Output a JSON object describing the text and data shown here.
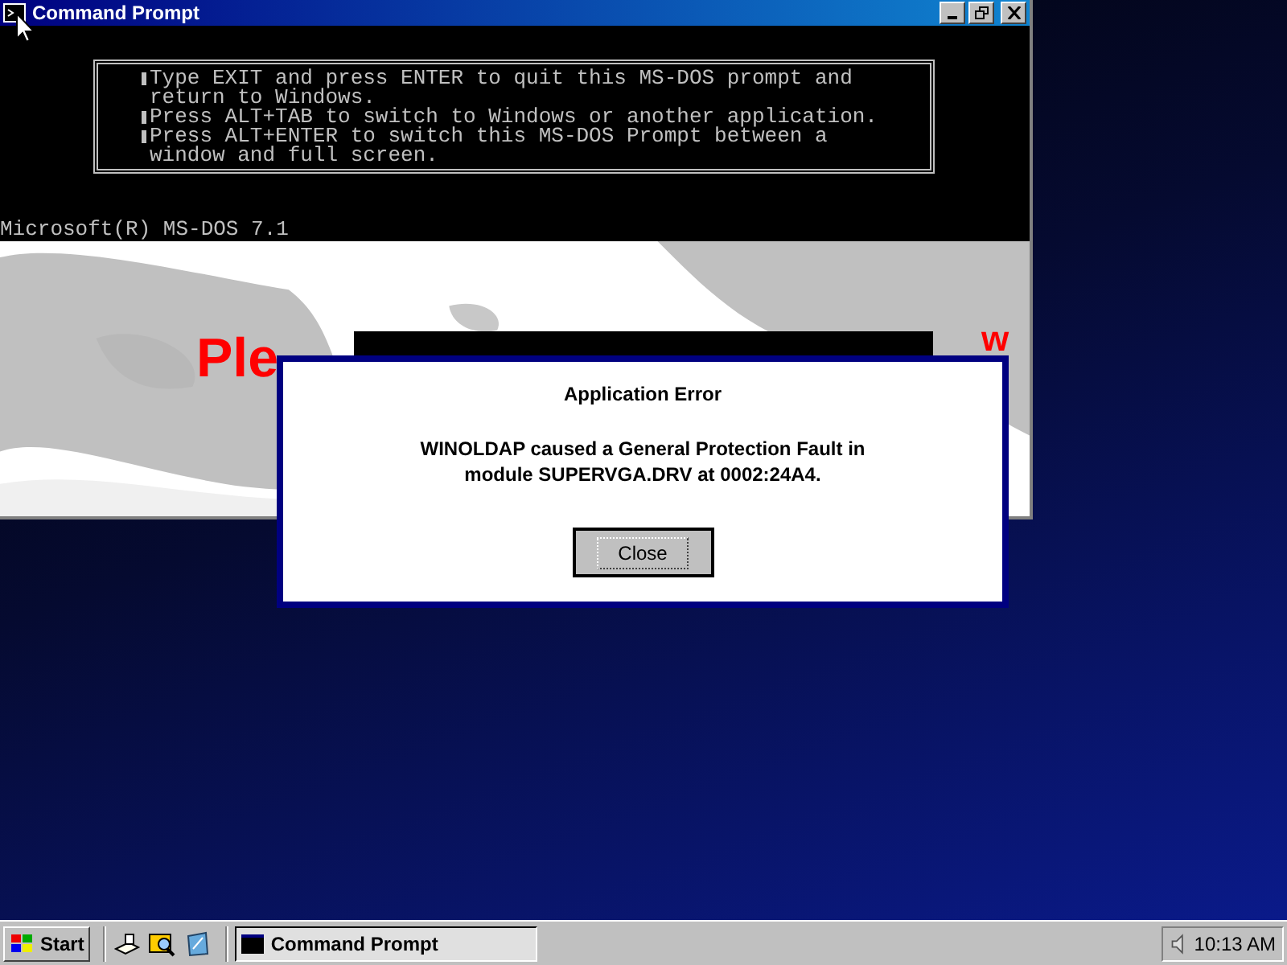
{
  "window": {
    "title": "Command Prompt",
    "info_items": [
      "Type EXIT and press ENTER to quit this MS-DOS prompt and\nreturn to Windows.",
      "Press ALT+TAB to switch to Windows or another application.",
      "Press ALT+ENTER to switch this MS-DOS Prompt between a\nwindow and full screen."
    ],
    "prompt_line": "Microsoft(R) MS-DOS 7.1",
    "graphics_text": [
      "Ple",
      "w"
    ]
  },
  "dialog": {
    "title": "Application Error",
    "message": "WINOLDAP caused a General Protection Fault in\nmodule SUPERVGA.DRV at 0002:24A4.",
    "buttons": [
      "Close"
    ]
  },
  "taskbar": {
    "start": "Start",
    "tasks": [
      {
        "label": "Command Prompt",
        "selected": true
      }
    ],
    "clock": "10:13 AM"
  }
}
